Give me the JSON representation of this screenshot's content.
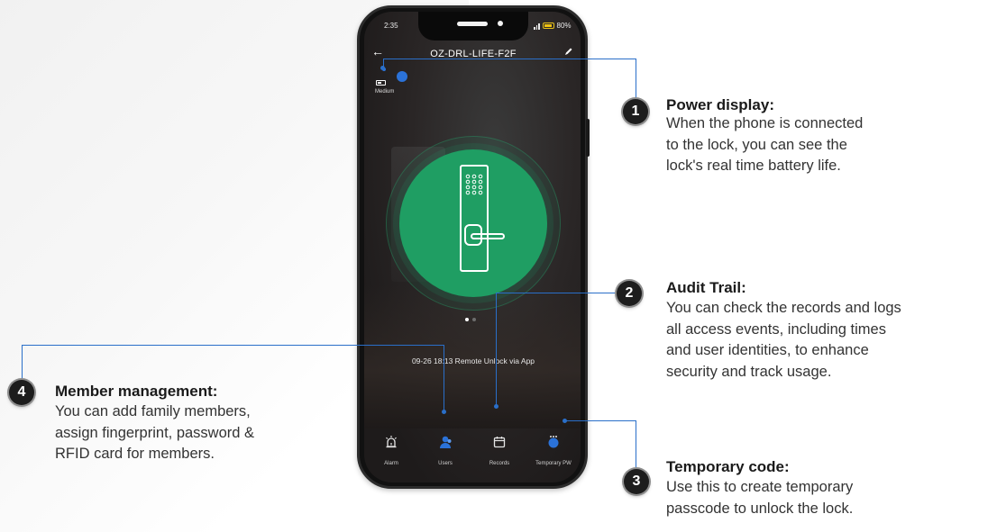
{
  "phone": {
    "status_time": "2:35",
    "battery_percent": "80%",
    "app_title": "OZ-DRL-LIFE-F2F",
    "lock_battery_label": "Medium",
    "event_text": "09-26 18:13  Remote Unlock via App",
    "tabs": [
      {
        "label": "Alarm",
        "icon": "alarm-icon"
      },
      {
        "label": "Users",
        "icon": "users-icon"
      },
      {
        "label": "Records",
        "icon": "calendar-icon"
      },
      {
        "label": "Temporary PW",
        "icon": "temporary-password-icon"
      }
    ]
  },
  "callouts": [
    {
      "number": "1",
      "title": "Power display:",
      "lines": [
        "When the phone is connected",
        "to the lock, you can see the",
        "lock's real time battery life."
      ]
    },
    {
      "number": "2",
      "title": "Audit Trail:",
      "lines": [
        "You can check the records and logs",
        "all access events, including times",
        "and user identities, to enhance",
        "security and track usage."
      ]
    },
    {
      "number": "3",
      "title": "Temporary code:",
      "lines": [
        "Use this to create temporary",
        "passcode to unlock the lock."
      ]
    },
    {
      "number": "4",
      "title": "Member management:",
      "lines": [
        "You can add family members,",
        "assign fingerprint, password &",
        "RFID card for members."
      ]
    }
  ],
  "colors": {
    "accent_line": "#2a6fc9",
    "lock_green": "#1f9e63",
    "tab_icon_blue": "#2b72d8"
  }
}
